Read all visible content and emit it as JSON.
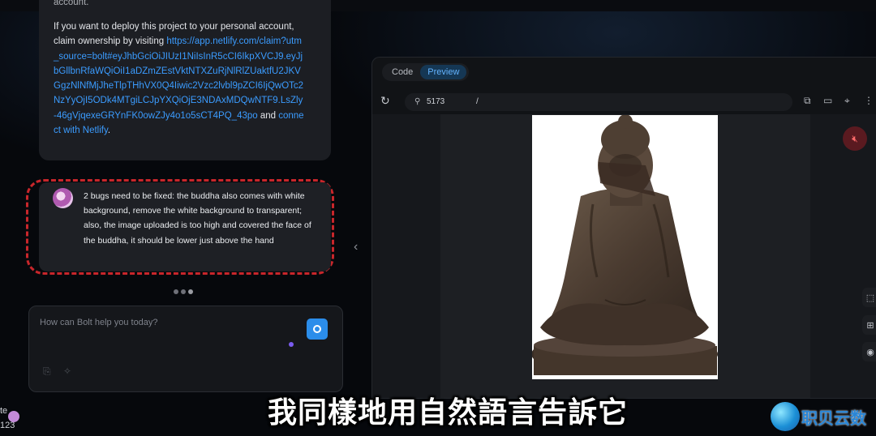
{
  "chat": {
    "assistant_cut_line": "account.",
    "deploy_text": "If you want to deploy this project to your personal account, claim ownership by visiting ",
    "claim_link": "https://app.netlify.com/claim?utm_source=bolt#eyJhbGciOiJIUzI1NiIsInR5cCI6IkpXVCJ9.eyJjbGllbnRfaWQiOiI1aDZmZEstVktNTXZuRjNlRlZUaktfU2JKVGgzNlNfMjJheTlpTHhVX0Q4Iiwic2Vzc2lvbl9pZCI6IjQwOTc2NzYyOjI5ODk4MTgiLCJpYXQiOjE3NDAxMDQwNTF9.LsZly-46gVjqexeGRYnFK0owZJy4o1o5sCT4PQ_43po",
    "and_text": " and ",
    "connect_link": "connect with Netlify",
    "period": ".",
    "user_message": "2 bugs need to be fixed: the buddha also comes with white background, remove the white background to transparent; also, the image uploaded is too high and covered the face of the buddha, it should be lower just above the hand"
  },
  "input": {
    "placeholder": "How can Bolt help you today?"
  },
  "workbench": {
    "tabs": [
      {
        "label": "Code",
        "active": false
      },
      {
        "label": "Preview",
        "active": true
      }
    ],
    "port": "5173",
    "path": "/"
  },
  "subtitle": "我同樣地用自然語言告訴它",
  "watermark": "职贝云数",
  "corner": {
    "line1": "te",
    "line2": "123"
  },
  "colors": {
    "accent": "#2b8dea",
    "link": "#3b9cff",
    "highlight_border": "#c8262b"
  }
}
